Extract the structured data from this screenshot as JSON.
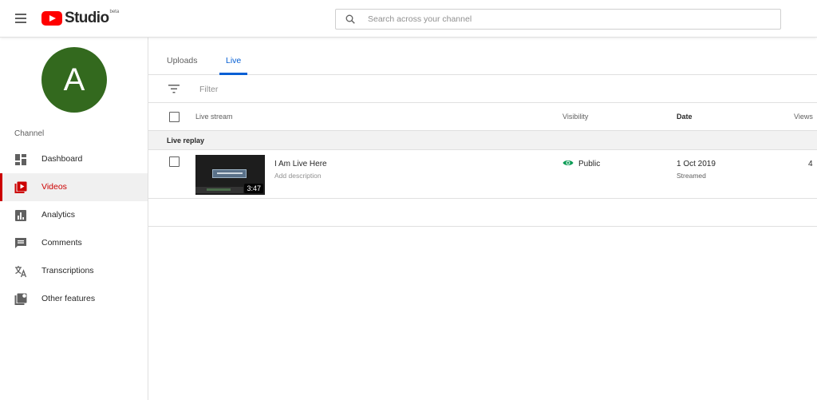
{
  "app": {
    "name": "Studio",
    "beta": "beta"
  },
  "search": {
    "placeholder": "Search across your channel"
  },
  "avatar": {
    "initial": "A",
    "color": "#33691e"
  },
  "sidebar": {
    "section_label": "Channel",
    "items": [
      {
        "label": "Dashboard",
        "icon": "dashboard-icon",
        "active": false
      },
      {
        "label": "Videos",
        "icon": "videos-icon",
        "active": true
      },
      {
        "label": "Analytics",
        "icon": "analytics-icon",
        "active": false
      },
      {
        "label": "Comments",
        "icon": "comments-icon",
        "active": false
      },
      {
        "label": "Transcriptions",
        "icon": "transcriptions-icon",
        "active": false
      },
      {
        "label": "Other features",
        "icon": "other-features-icon",
        "active": false
      }
    ]
  },
  "tabs": [
    {
      "label": "Uploads",
      "active": false
    },
    {
      "label": "Live",
      "active": true
    }
  ],
  "filter": {
    "placeholder": "Filter"
  },
  "table": {
    "columns": {
      "live_stream": "Live stream",
      "visibility": "Visibility",
      "date": "Date",
      "views": "Views"
    },
    "section_label": "Live replay",
    "rows": [
      {
        "title": "I Am Live Here",
        "description": "Add description",
        "duration": "3:47",
        "visibility": "Public",
        "date": "1 Oct 2019",
        "date_status": "Streamed",
        "views": "4"
      }
    ]
  },
  "colors": {
    "accent_red": "#cc0000",
    "accent_blue": "#065fd4",
    "public_green": "#0f9d58"
  }
}
